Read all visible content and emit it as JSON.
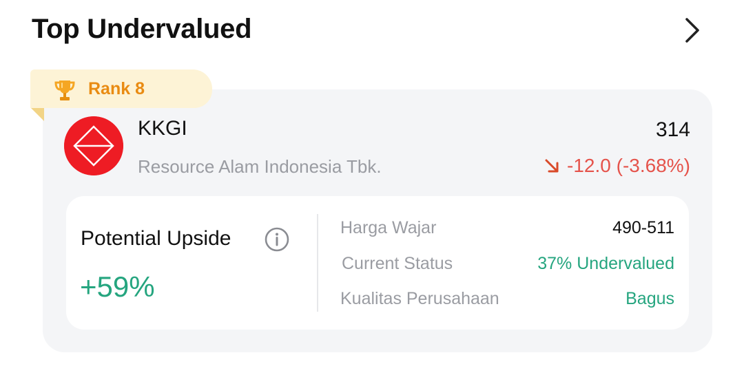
{
  "header": {
    "title": "Top Undervalued",
    "more_icon": "chevron-right-icon"
  },
  "card": {
    "rank_label": "Rank 8",
    "rank_icon": "trophy-icon",
    "logo_icon": "kkgi-logo",
    "ticker": "KKGI",
    "company_name": "Resource Alam Indonesia Tbk.",
    "price": "314",
    "change": "-12.0 (-3.68%)",
    "change_icon": "arrow-down-right-icon",
    "potential_upside_label": "Potential Upside",
    "info_icon": "info-icon",
    "potential_upside_value": "+59%",
    "rows": [
      {
        "label": "Harga Wajar",
        "value": "490-511"
      },
      {
        "label": "Current Status",
        "value": "37% Undervalued"
      },
      {
        "label": "Kualitas Perusahaan",
        "value": "Bagus"
      }
    ]
  },
  "colors": {
    "positive": "#25a57f",
    "negative": "#e5534b",
    "rank": "#e98b12",
    "logo": "#ee1c24",
    "muted_text": "#9a9ca2"
  }
}
